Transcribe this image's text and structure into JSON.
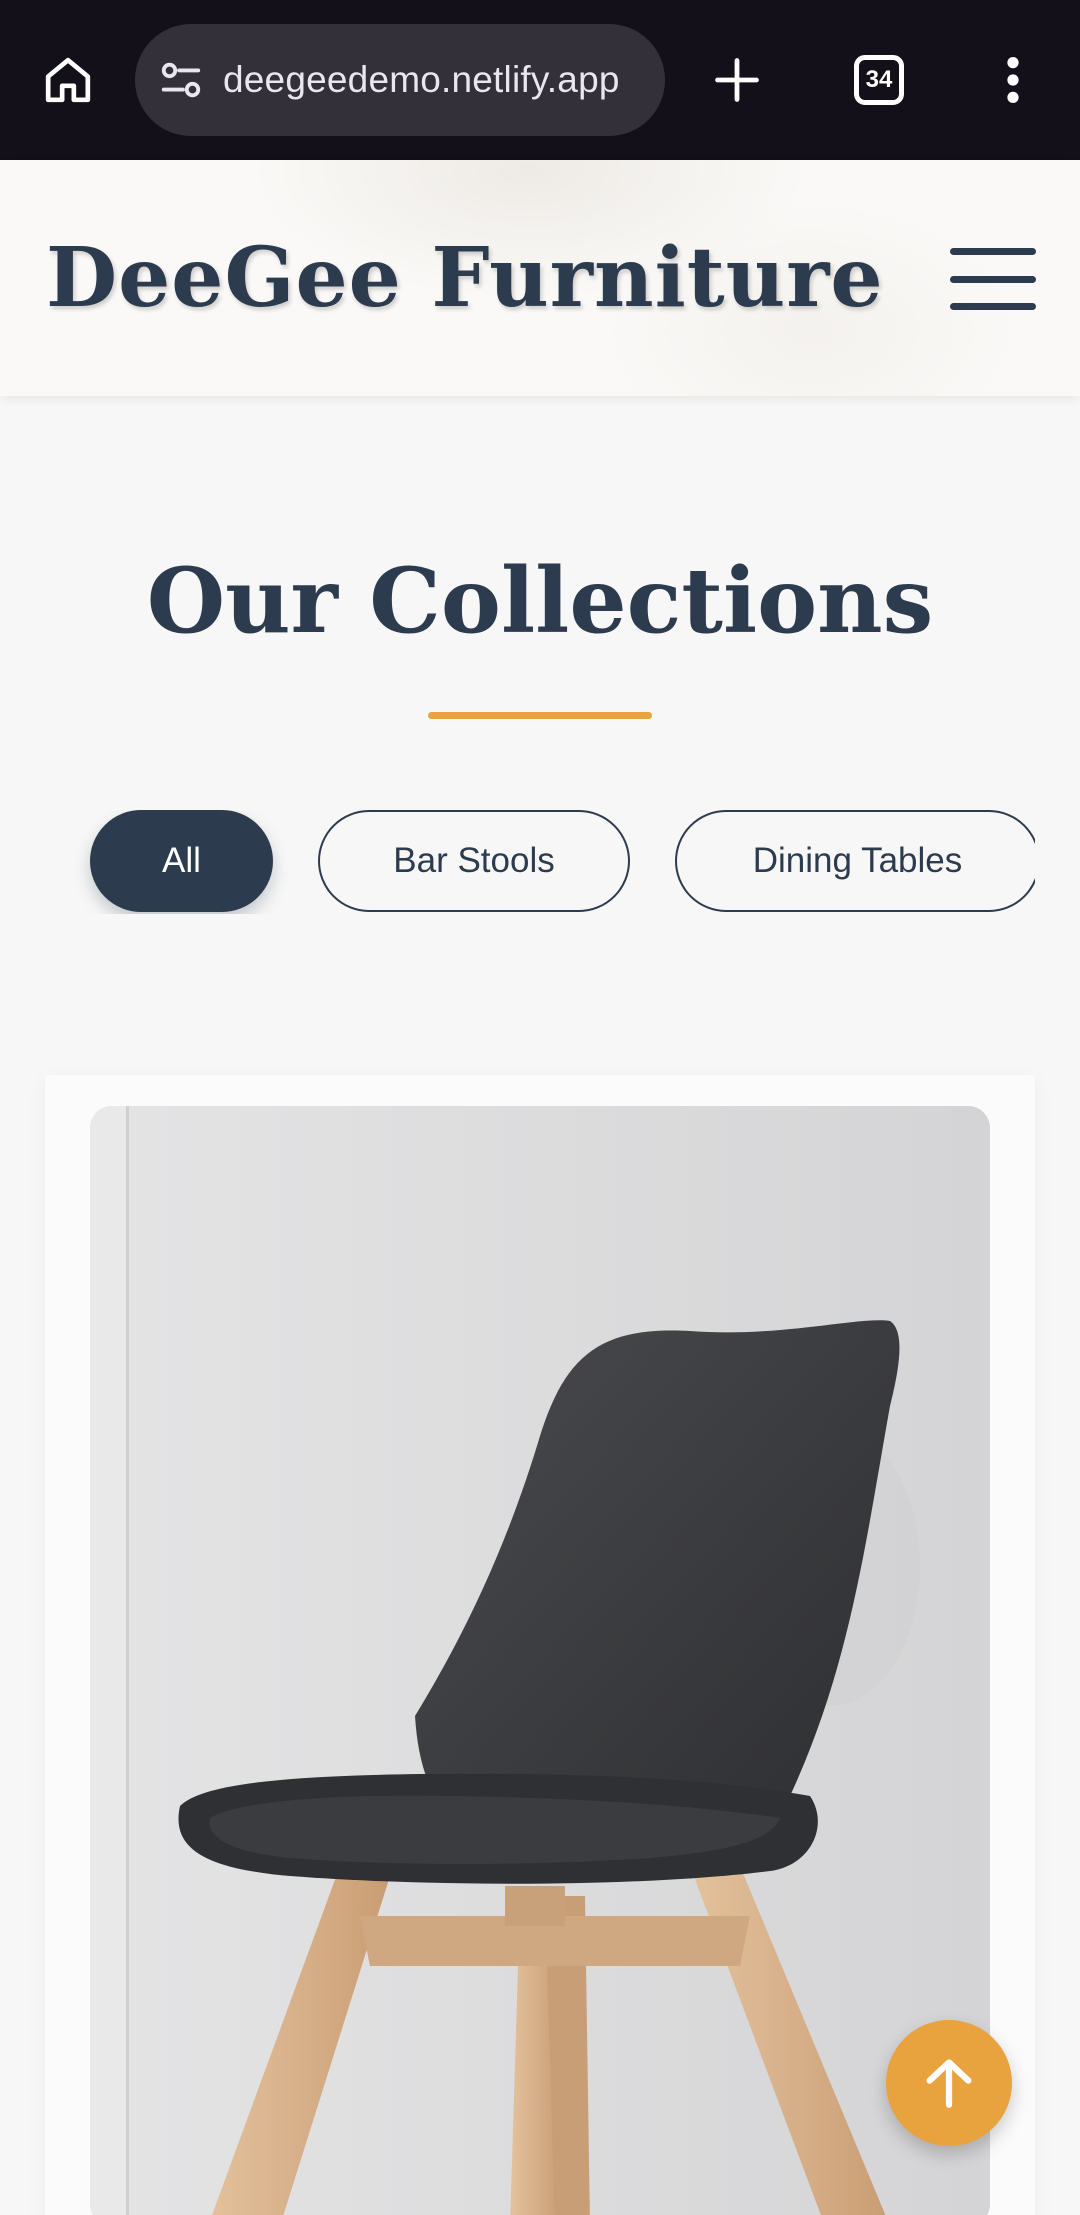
{
  "browser": {
    "url": "deegeedemo.netlify.app",
    "tab_count": "34"
  },
  "site": {
    "brand": "DeeGee Furniture"
  },
  "collections": {
    "title": "Our Collections",
    "filters": [
      {
        "label": "All",
        "active": true
      },
      {
        "label": "Bar Stools",
        "active": false
      },
      {
        "label": "Dining Tables",
        "active": false
      }
    ]
  },
  "colors": {
    "navy": "#2d3b4e",
    "accent": "#e8a23e",
    "chrome_bg": "#14101a"
  },
  "icons": [
    "home-icon",
    "site-settings-icon",
    "plus-icon",
    "tab-switcher-icon",
    "more-vert-icon",
    "hamburger-menu-icon",
    "arrow-up-icon"
  ]
}
